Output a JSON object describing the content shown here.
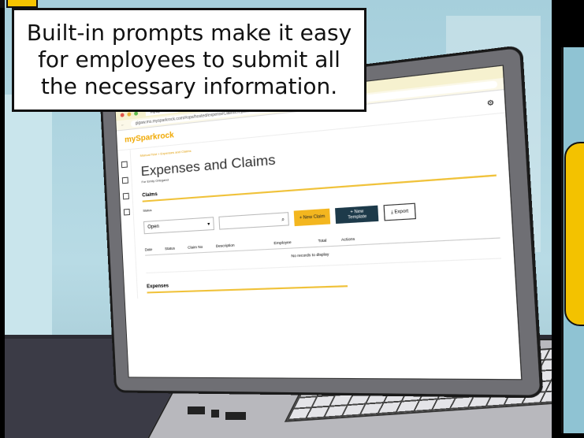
{
  "caption": {
    "text": "Built-in prompts make it easy for employees to submit all the necessary information."
  },
  "browser": {
    "tab_label": "mySparkrock",
    "url": "gigaw.ms.mysparkrock.com/#ops/hosted/expenseClaims.report"
  },
  "app": {
    "logo": "mySparkrock",
    "breadcrumb": "Manual Test > Expenses and Claims",
    "page_title": "Expenses and Claims",
    "subtitle": "For Emily Ortegand"
  },
  "claims": {
    "section_title": "Claims",
    "status_label": "Status",
    "status_value": "Open",
    "search_glyph": "⌕",
    "buttons": {
      "new_claim": "+ New Claim",
      "new_template": "+ New Template",
      "export": "⤓ Export"
    },
    "columns": [
      "Date",
      "Status",
      "Claim No",
      "Description",
      "Employee",
      "Total",
      "Actions"
    ],
    "empty_message": "No records to display"
  },
  "expenses": {
    "section_title": "Expenses"
  },
  "colors": {
    "accent": "#f3b61f",
    "dark_button": "#1d3a4a",
    "caption_bg": "#ffffff"
  }
}
